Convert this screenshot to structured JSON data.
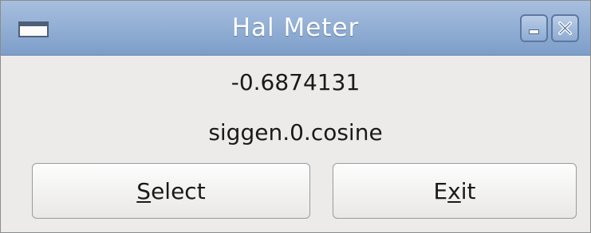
{
  "window": {
    "title": "Hal Meter",
    "controls": {
      "minimize_icon": "minimize-icon",
      "close_icon": "close-icon"
    }
  },
  "meter": {
    "value": "-0.6874131",
    "signal": "siggen.0.cosine"
  },
  "buttons": {
    "select": {
      "mnemonic": "S",
      "rest": "elect"
    },
    "exit": {
      "before": "E",
      "mnemonic": "x",
      "after": "it"
    }
  },
  "colors": {
    "titlebar_top": "#a7bfdf",
    "titlebar_bottom": "#7d9ec9",
    "window_bg": "#ecebea"
  }
}
